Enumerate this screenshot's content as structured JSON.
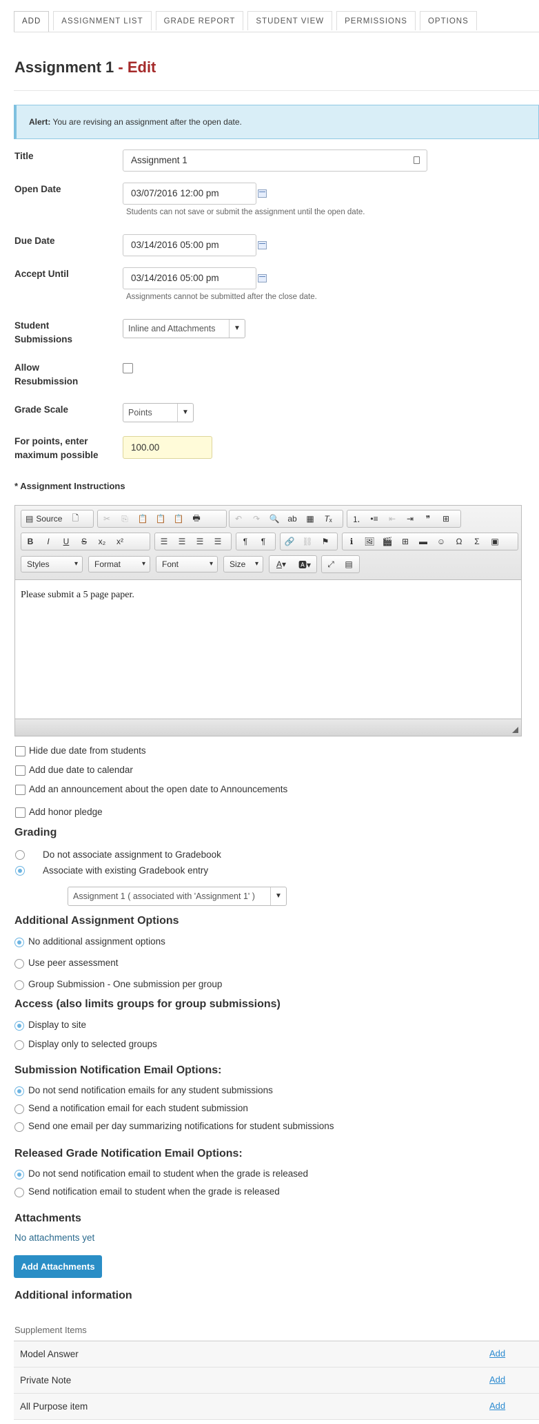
{
  "tabs": [
    {
      "label": "ADD",
      "active": true
    },
    {
      "label": "ASSIGNMENT LIST",
      "active": false
    },
    {
      "label": "GRADE REPORT",
      "active": false
    },
    {
      "label": "STUDENT VIEW",
      "active": false
    },
    {
      "label": "PERMISSIONS",
      "active": false
    },
    {
      "label": "OPTIONS",
      "active": false
    }
  ],
  "page": {
    "title": "Assignment 1",
    "separator": " - ",
    "mode": "Edit"
  },
  "alert": {
    "prefix": "Alert:",
    "message": "You are revising an assignment after the open date."
  },
  "form": {
    "title_label": "Title",
    "title_value": "Assignment 1",
    "open_date_label": "Open Date",
    "open_date_value": "03/07/2016 12:00 pm",
    "open_date_hint": "Students can not save or submit the assignment until the open date.",
    "due_date_label": "Due Date",
    "due_date_value": "03/14/2016 05:00 pm",
    "accept_until_label": "Accept Until",
    "accept_until_value": "03/14/2016 05:00 pm",
    "accept_until_hint": "Assignments cannot be submitted after the close date.",
    "student_submissions_label_1": "Student",
    "student_submissions_label_2": "Submissions",
    "student_submissions_value": "Inline and Attachments",
    "allow_resubmission_label_1": "Allow",
    "allow_resubmission_label_2": "Resubmission",
    "grade_scale_label": "Grade Scale",
    "grade_scale_value": "Points",
    "max_points_label_1": "For points, enter",
    "max_points_label_2": "maximum possible",
    "max_points_value": "100.00",
    "instructions_label": "* Assignment Instructions"
  },
  "editor": {
    "source_label": "Source",
    "styles_label": "Styles",
    "format_label": "Format",
    "font_label": "Font",
    "size_label": "Size",
    "content": "Please submit a 5 page paper."
  },
  "options": {
    "hide_due_date": "Hide due date from students",
    "add_to_calendar": "Add due date to calendar",
    "add_announcement": "Add an announcement about the open date to Announcements",
    "honor_pledge": "Add honor pledge"
  },
  "grading": {
    "title": "Grading",
    "no_gradebook": "Do not associate assignment to Gradebook",
    "existing_gradebook": "Associate with existing Gradebook entry",
    "gradebook_entry": "Assignment 1 ( associated with 'Assignment 1' )"
  },
  "additional": {
    "title": "Additional Assignment Options",
    "none": "No additional assignment options",
    "peer": "Use peer assessment",
    "group": "Group Submission - One submission per group"
  },
  "access": {
    "title": "Access (also limits groups for group submissions)",
    "site": "Display to site",
    "groups": "Display only to selected groups"
  },
  "submission_email": {
    "title": "Submission Notification Email Options:",
    "none": "Do not send notification emails for any student submissions",
    "each": "Send a notification email for each student submission",
    "daily": "Send one email per day summarizing notifications for student submissions"
  },
  "grade_email": {
    "title": "Released Grade Notification Email Options:",
    "none": "Do not send notification email to student when the grade is released",
    "send": "Send notification email to student when the grade is released"
  },
  "attachments": {
    "title": "Attachments",
    "empty": "No attachments yet",
    "button": "Add Attachments"
  },
  "info": {
    "title": "Additional information",
    "supplement_title": "Supplement Items",
    "items": [
      {
        "name": "Model Answer",
        "action": "Add"
      },
      {
        "name": "Private Note",
        "action": "Add"
      },
      {
        "name": "All Purpose item",
        "action": "Add"
      }
    ]
  }
}
